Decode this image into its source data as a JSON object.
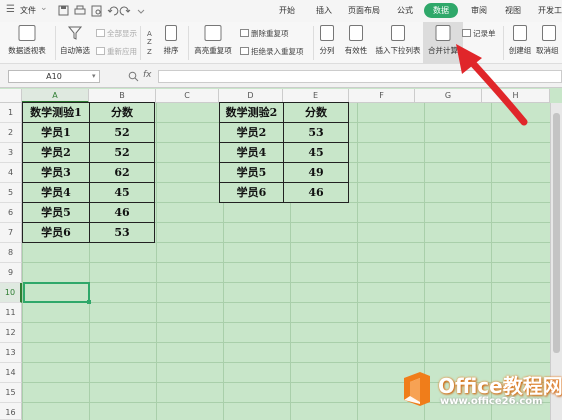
{
  "titlebar": {
    "menu_icon": "hamburger-icon",
    "file_label": "文件",
    "file_arrow": "⌄",
    "quick_icons": [
      "save-icon",
      "print-icon",
      "preview-icon",
      "undo-icon",
      "redo-icon",
      "customize-icon"
    ]
  },
  "tabs": [
    {
      "label": "开始"
    },
    {
      "label": "插入"
    },
    {
      "label": "页面布局"
    },
    {
      "label": "公式"
    },
    {
      "label": "数据",
      "active": true
    },
    {
      "label": "审阅"
    },
    {
      "label": "视图"
    },
    {
      "label": "开发工"
    }
  ],
  "ribbon": {
    "pivot_table": "数据透视表",
    "autofilter": "自动筛选",
    "show_all": "全部显示",
    "reapply": "重新应用",
    "sort": "排序",
    "highlight_dup": "高亮重复项",
    "delete_dup": "删除重复项",
    "reject_dup": "拒绝录入重复项",
    "text_to_columns": "分列",
    "validation": "有效性",
    "insert_dropdown": "插入下拉列表",
    "consolidate": "合并计算",
    "record_form": "记录单",
    "create_group": "创建组",
    "ungroup": "取消组"
  },
  "formula_bar": {
    "name_box": "A10",
    "zoom_icon": "magnifier-icon",
    "fx_label": "fx",
    "formula": ""
  },
  "columns": [
    "A",
    "B",
    "C",
    "D",
    "E",
    "F",
    "G",
    "H"
  ],
  "selected_column": "A",
  "rows": [
    "1",
    "2",
    "3",
    "4",
    "5",
    "6",
    "7",
    "8",
    "9",
    "10",
    "11",
    "12",
    "13",
    "14",
    "15",
    "16"
  ],
  "selected_row": "10",
  "table1": {
    "header": [
      "数学测验1",
      "分数"
    ],
    "rows": [
      [
        "学员1",
        "52"
      ],
      [
        "学员2",
        "52"
      ],
      [
        "学员3",
        "62"
      ],
      [
        "学员4",
        "45"
      ],
      [
        "学员5",
        "46"
      ],
      [
        "学员6",
        "53"
      ]
    ]
  },
  "table2": {
    "header": [
      "数学测验2",
      "分数"
    ],
    "rows": [
      [
        "学员2",
        "53"
      ],
      [
        "学员4",
        "45"
      ],
      [
        "学员5",
        "49"
      ],
      [
        "学员6",
        "46"
      ]
    ]
  },
  "watermark": {
    "line1": "Office教程网",
    "line2": "www.office26.com"
  },
  "colors": {
    "accent": "#2fa86a",
    "sheet_bg": "#c8e6c9",
    "arrow": "#e0262a",
    "watermark_orange": "#f07d1a"
  }
}
